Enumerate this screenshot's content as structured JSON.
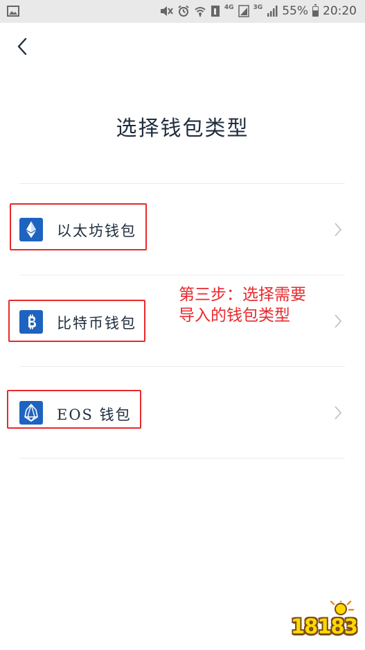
{
  "status_bar": {
    "network_a": "4G",
    "network_b": "3G",
    "battery_percent": "55%",
    "battery_level": 0.55,
    "time": "20:20",
    "icons": [
      "image-icon",
      "mute-icon",
      "alarm-icon",
      "wifi-icon",
      "sim-icon",
      "signal-icon",
      "signal-icon",
      "battery-icon"
    ]
  },
  "header": {
    "back_icon": "chevron-left-icon"
  },
  "page_title": "选择钱包类型",
  "wallet_types": [
    {
      "label": "以太坊钱包",
      "icon": "ethereum-icon",
      "chevron": "chevron-right-icon"
    },
    {
      "label": "比特币钱包",
      "icon": "bitcoin-icon",
      "chevron": "chevron-right-icon"
    },
    {
      "label": "EOS 钱包",
      "icon": "eos-icon",
      "chevron": "chevron-right-icon"
    }
  ],
  "annotation": {
    "line1": "第三步：选择需要",
    "line2": "导入的钱包类型"
  },
  "watermark": {
    "text": "18183",
    "icon": "site-logo-icon"
  },
  "colors": {
    "brand_blue": "#1e63c0",
    "annotation_red": "#e8282c",
    "title_text": "#1f2d3d",
    "divider": "#ececec",
    "status_bar_bg": "#e9e9e9"
  }
}
